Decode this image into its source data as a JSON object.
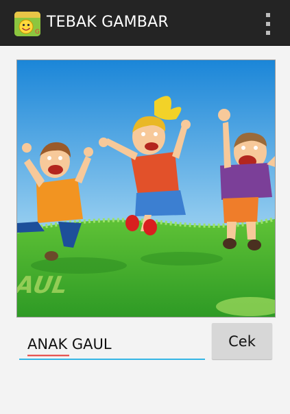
{
  "app": {
    "title": "TEBAK GAMBAR",
    "icon": "smiley-app-icon",
    "menu_icon": "overflow-menu-icon"
  },
  "puzzle": {
    "image_subject": "three cartoon children jumping on a grassy hill",
    "image_text": "GAUL"
  },
  "answer": {
    "value": "ANAK GAUL"
  },
  "actions": {
    "check_label": "Cek"
  },
  "colors": {
    "action_bar": "#242424",
    "input_underline": "#33b5e5",
    "button": "#d7d7d7",
    "sky": "#2f9be0",
    "grass": "#3cae2e"
  }
}
